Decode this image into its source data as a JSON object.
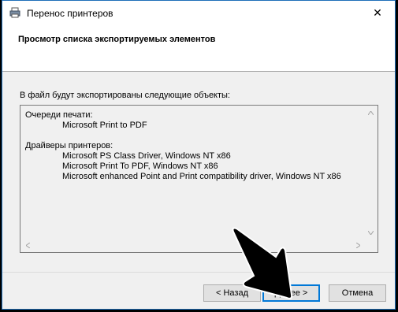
{
  "window": {
    "title": "Перенос принтеров",
    "close_glyph": "✕"
  },
  "header": {
    "title": "Просмотр списка экспортируемых элементов"
  },
  "body": {
    "intro": "В файл будут экспортированы следующие объекты:",
    "queues_heading": "Очереди печати:",
    "queues": [
      "Microsoft Print to PDF"
    ],
    "drivers_heading": "Драйверы принтеров:",
    "drivers": [
      "Microsoft PS Class Driver, Windows NT x86",
      "Microsoft Print To PDF, Windows NT x86",
      "Microsoft enhanced Point and Print compatibility driver, Windows NT x86"
    ]
  },
  "buttons": {
    "back": "< Назад",
    "next": "Далее >",
    "cancel": "Отмена"
  },
  "colors": {
    "accent": "#0078d7",
    "window_border": "#1f6fb9",
    "background": "#f0f0f0"
  },
  "icons": {
    "app": "printer-icon",
    "close": "close-icon",
    "cursor": "mouse-pointer-icon"
  }
}
